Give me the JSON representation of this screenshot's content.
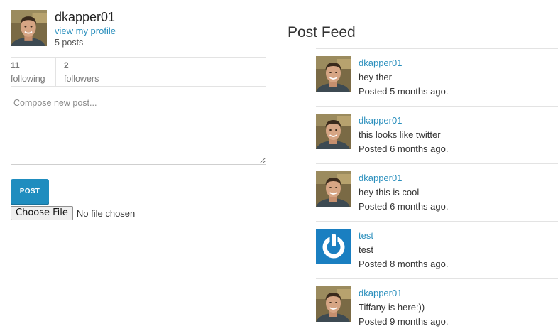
{
  "profile": {
    "username": "dkapper01",
    "view_profile_label": "view my profile",
    "posts_count": "5 posts"
  },
  "stats": {
    "following_count": "11",
    "following_label": "following",
    "followers_count": "2",
    "followers_label": "followers"
  },
  "compose": {
    "placeholder": "Compose new post...",
    "post_button_label": "POST",
    "choose_file_label": "Choose File",
    "no_file_label": "No file chosen"
  },
  "feed": {
    "title": "Post Feed",
    "posts": [
      {
        "user": "dkapper01",
        "text": "hey ther",
        "time": "Posted 5 months ago.",
        "avatar": "photo-avatar"
      },
      {
        "user": "dkapper01",
        "text": "this looks like twitter",
        "time": "Posted 6 months ago.",
        "avatar": "photo-avatar"
      },
      {
        "user": "dkapper01",
        "text": "hey this is cool",
        "time": "Posted 6 months ago.",
        "avatar": "photo-avatar"
      },
      {
        "user": "test",
        "text": "test",
        "time": "Posted 8 months ago.",
        "avatar": "power-icon"
      },
      {
        "user": "dkapper01",
        "text": "Tiffany is here:))",
        "time": "Posted 9 months ago.",
        "avatar": "photo-avatar"
      }
    ]
  },
  "colors": {
    "link": "#2a8fbd",
    "button": "#1f8dbf",
    "default_avatar_bg": "#1a7fc1"
  }
}
